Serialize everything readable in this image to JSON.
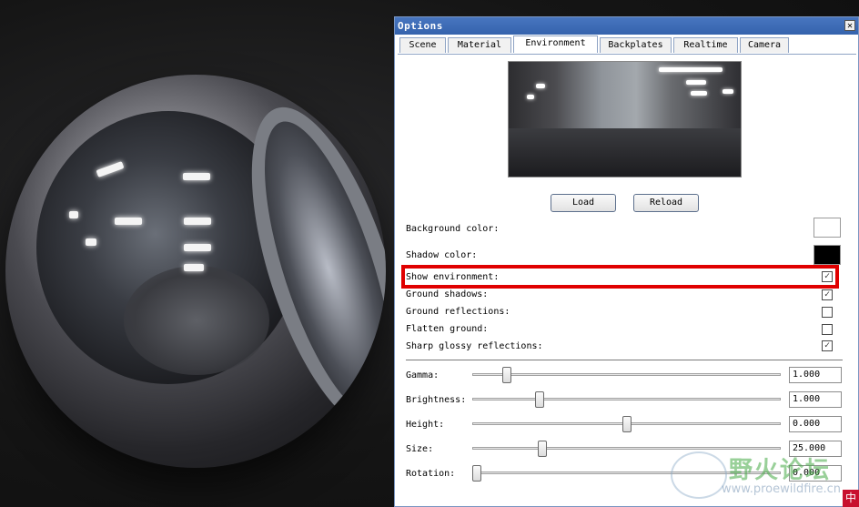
{
  "window": {
    "title": "Options",
    "close_glyph": "✕"
  },
  "tabs": [
    {
      "label": "Scene",
      "active": false
    },
    {
      "label": "Material",
      "active": false
    },
    {
      "label": "Environment",
      "active": true
    },
    {
      "label": "Backplates",
      "active": false
    },
    {
      "label": "Realtime",
      "active": false
    },
    {
      "label": "Camera",
      "active": false
    }
  ],
  "buttons": {
    "load": "Load",
    "reload": "Reload"
  },
  "colors": {
    "background_label": "Background color:",
    "background_value": "#ffffff",
    "shadow_label": "Shadow color:",
    "shadow_value": "#000000",
    "highlight": "#e00000"
  },
  "options": [
    {
      "label": "Show environment:",
      "checked": true
    },
    {
      "label": "Ground shadows:",
      "checked": true
    },
    {
      "label": "Ground reflections:",
      "checked": false
    },
    {
      "label": "Flatten ground:",
      "checked": false
    },
    {
      "label": "Sharp glossy reflections:",
      "checked": true
    }
  ],
  "sliders": [
    {
      "label": "Gamma:",
      "value": "1.000",
      "level": 0.1
    },
    {
      "label": "Brightness:",
      "value": "1.000",
      "level": 0.21
    },
    {
      "label": "Height:",
      "value": "0.000",
      "level": 0.5
    },
    {
      "label": "Size:",
      "value": "25.000",
      "level": 0.22
    },
    {
      "label": "Rotation:",
      "value": "0.000",
      "level": 0.0
    }
  ],
  "watermark": {
    "text_cn": "野火论坛",
    "url": "www.proewildfire.cn",
    "corner_glyph": "中"
  },
  "icons": {
    "close": "close-icon",
    "check": "checkmark-icon",
    "logo": "forum-logo-icon"
  }
}
